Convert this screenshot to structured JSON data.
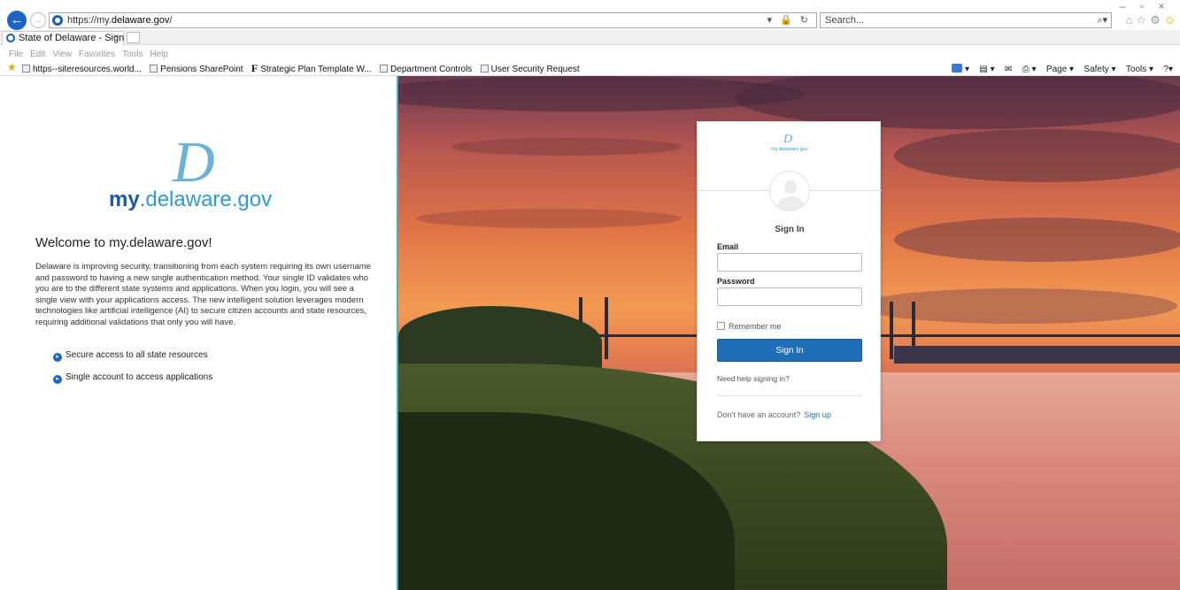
{
  "browser": {
    "url_scheme": "https://my.",
    "url_domain": "delaware.gov",
    "url_path": "/",
    "url_controls": "▾ 🔒 ↻",
    "search_placeholder": "Search...",
    "search_icon": "⌕▾",
    "tab_title": "State of Delaware - Sign In",
    "tab_close": "×",
    "menu": [
      "File",
      "Edit",
      "View",
      "Favorites",
      "Tools",
      "Help"
    ],
    "favorites": [
      "https--siteresources.world...",
      "Pensions SharePoint",
      "Strategic Plan Template W...",
      "Department Controls",
      "User Security Request"
    ],
    "commands": [
      "Page ▾",
      "Safety ▾",
      "Tools ▾"
    ],
    "window_controls": [
      "–",
      "▫",
      "×"
    ],
    "toolbar_icons": [
      "⌂",
      "☆",
      "⚙",
      "☺"
    ]
  },
  "left": {
    "brand_letter": "D",
    "brand_my": "my",
    "brand_rest": ".delaware.gov",
    "welcome": "Welcome to my.delaware.gov!",
    "description": "Delaware is improving security, transitioning from each system requiring its own username and password to having a new single authentication method. Your single ID validates who you are to the different state systems and applications. When you login, you will see a single view with your applications access. The new intelligent solution leverages modern technologies like artificial intelligence (AI) to secure citizen accounts and state resources, requiring additional validations that only you will have.",
    "bullets": [
      "Secure access to all state resources",
      "Single account to access applications"
    ]
  },
  "card": {
    "logo_letter": "D",
    "logo_text": "my.delaware.gov",
    "title": "Sign In",
    "email_label": "Email",
    "email_value": "",
    "password_label": "Password",
    "password_value": "",
    "remember_label": "Remember me",
    "signin_button": "Sign In",
    "help_link": "Need help signing in?",
    "no_account": "Don't have an account?",
    "signup_link": "Sign up"
  },
  "colors": {
    "accent_blue": "#1f6fb8",
    "brand_light": "#2f9ad9",
    "brand_dark": "#1c5aa6",
    "panel_border": "#3fb1c5"
  }
}
